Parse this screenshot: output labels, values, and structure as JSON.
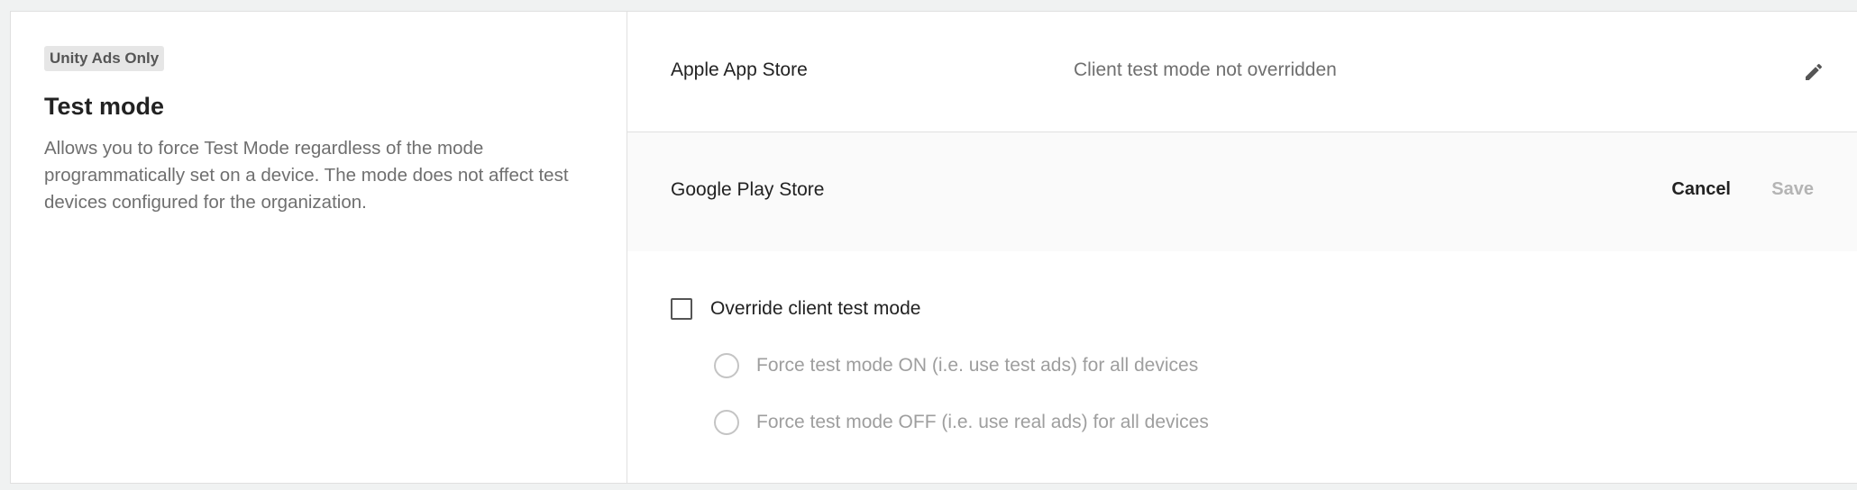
{
  "section": {
    "badge": "Unity Ads Only",
    "title": "Test mode",
    "description": "Allows you to force Test Mode regardless of the mode programmatically set on a device. The mode does not affect test devices configured for the organization."
  },
  "stores": {
    "apple": {
      "name": "Apple App Store",
      "status": "Client test mode not overridden",
      "icon": "pencil-icon"
    },
    "google": {
      "name": "Google Play Store",
      "cancel_label": "Cancel",
      "save_label": "Save",
      "override": {
        "label": "Override client test mode",
        "checked": false
      },
      "options": [
        {
          "label": "Force test mode ON (i.e. use test ads) for all devices",
          "selected": false
        },
        {
          "label": "Force test mode OFF (i.e. use real ads) for all devices",
          "selected": false
        }
      ]
    }
  },
  "colors": {
    "border": "#e0e0e0",
    "badge_bg": "#e6e6e6",
    "muted_text": "#6f6f6f",
    "disabled_text": "#b4b4b4",
    "page_bg": "#f0f2f2"
  }
}
